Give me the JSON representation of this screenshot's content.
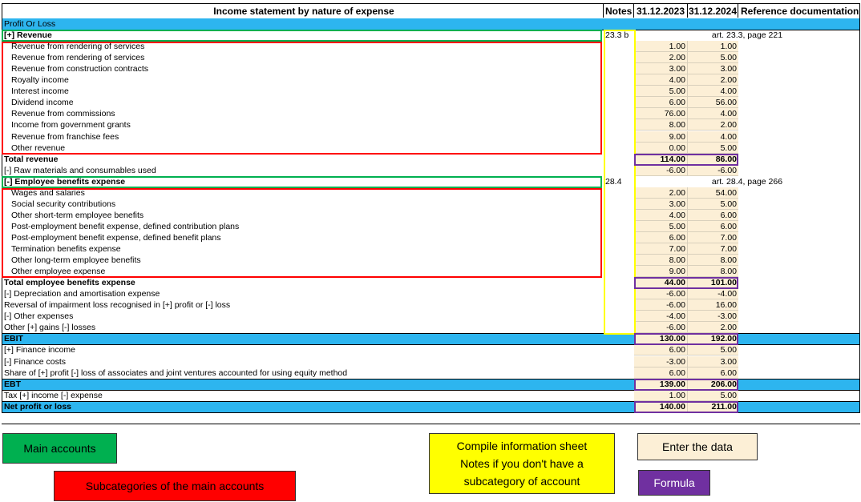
{
  "header": {
    "title": "Income statement by nature of expense",
    "notes": "Notes",
    "col1": "31.12.2023",
    "col2": "31.12.2024",
    "ref": "Reference documentation"
  },
  "rows": [
    {
      "label": "Profit Or Loss",
      "style": "blue"
    },
    {
      "label": "[+] Revenue",
      "style": "bold",
      "note": "23.3 b",
      "ref_merged": "art. 23.3, page 221"
    },
    {
      "label": "Revenue from rendering of services",
      "style": "sub",
      "v1": "1.00",
      "v2": "1.00"
    },
    {
      "label": "Revenue from rendering of services",
      "style": "sub",
      "v1": "2.00",
      "v2": "5.00"
    },
    {
      "label": "Revenue from construction contracts",
      "style": "sub",
      "v1": "3.00",
      "v2": "3.00"
    },
    {
      "label": "Royalty income",
      "style": "sub",
      "v1": "4.00",
      "v2": "2.00"
    },
    {
      "label": "Interest income",
      "style": "sub",
      "v1": "5.00",
      "v2": "4.00"
    },
    {
      "label": "Dividend income",
      "style": "sub",
      "v1": "6.00",
      "v2": "56.00"
    },
    {
      "label": "Revenue from commissions",
      "style": "sub",
      "v1": "76.00",
      "v2": "4.00"
    },
    {
      "label": "Income from government grants",
      "style": "sub",
      "v1": "8.00",
      "v2": "2.00"
    },
    {
      "label": "Revenue from franchise fees",
      "style": "sub",
      "v1": "9.00",
      "v2": "4.00"
    },
    {
      "label": "Other revenue",
      "style": "sub",
      "v1": "0.00",
      "v2": "5.00"
    },
    {
      "label": "Total revenue",
      "style": "bold",
      "v1": "114.00",
      "v2": "86.00"
    },
    {
      "label": "[-] Raw materials and consumables used",
      "style": "",
      "v1": "-6.00",
      "v2": "-6.00"
    },
    {
      "label": "[-] Employee benefits expense",
      "style": "bold",
      "note": "28.4",
      "ref_merged": "art. 28.4, page 266"
    },
    {
      "label": "Wages and salaries",
      "style": "sub",
      "v1": "2.00",
      "v2": "54.00"
    },
    {
      "label": "Social security contributions",
      "style": "sub",
      "v1": "3.00",
      "v2": "5.00"
    },
    {
      "label": "Other short-term employee benefits",
      "style": "sub",
      "v1": "4.00",
      "v2": "6.00"
    },
    {
      "label": "Post-employment benefit expense, defined contribution plans",
      "style": "sub",
      "v1": "5.00",
      "v2": "6.00"
    },
    {
      "label": "Post-employment benefit expense, defined benefit plans",
      "style": "sub",
      "v1": "6.00",
      "v2": "7.00"
    },
    {
      "label": "Termination benefits expense",
      "style": "sub",
      "v1": "7.00",
      "v2": "7.00"
    },
    {
      "label": "Other long-term employee benefits",
      "style": "sub",
      "v1": "8.00",
      "v2": "8.00"
    },
    {
      "label": "Other employee expense",
      "style": "sub",
      "v1": "9.00",
      "v2": "8.00"
    },
    {
      "label": "Total employee benefits expense",
      "style": "bold",
      "v1": "44.00",
      "v2": "101.00"
    },
    {
      "label": "[-] Depreciation and amortisation expense",
      "style": "",
      "v1": "-6.00",
      "v2": "-4.00"
    },
    {
      "label": "Reversal of impairment loss recognised in [+] profit or [-] loss",
      "style": "",
      "v1": "-6.00",
      "v2": "16.00"
    },
    {
      "label": "[-] Other expenses",
      "style": "",
      "v1": "-4.00",
      "v2": "-3.00"
    },
    {
      "label": "Other [+] gains [-] losses",
      "style": "",
      "v1": "-6.00",
      "v2": "2.00"
    },
    {
      "label": "EBIT",
      "style": "blue bold",
      "v1": "130.00",
      "v2": "192.00"
    },
    {
      "label": "[+] Finance income",
      "style": "",
      "v1": "6.00",
      "v2": "5.00"
    },
    {
      "label": "[-] Finance costs",
      "style": "",
      "v1": "-3.00",
      "v2": "3.00"
    },
    {
      "label": "Share of [+] profit [-] loss of associates and joint ventures accounted for using equity method",
      "style": "",
      "v1": "6.00",
      "v2": "6.00"
    },
    {
      "label": "EBT",
      "style": "blue bold",
      "v1": "139.00",
      "v2": "206.00"
    },
    {
      "label": "Tax [+] income [-] expense",
      "style": "",
      "v1": "1.00",
      "v2": "5.00"
    },
    {
      "label": "Net profit or loss",
      "style": "blue bold",
      "v1": "140.00",
      "v2": "211.00"
    }
  ],
  "legend": {
    "main": "Main accounts",
    "sub": "Subcategories of the main accounts",
    "notes_line1": "Compile information sheet",
    "notes_line2": "Notes if you don't have a",
    "notes_line3": "subcategory of account",
    "enter": "Enter the data",
    "formula": "Formula"
  },
  "colors": {
    "green": "#00b050",
    "red": "#ff0000",
    "yellow": "#ffff00",
    "purple": "#7030a0",
    "cream": "#fcefd6",
    "blue": "#2db5ef"
  }
}
